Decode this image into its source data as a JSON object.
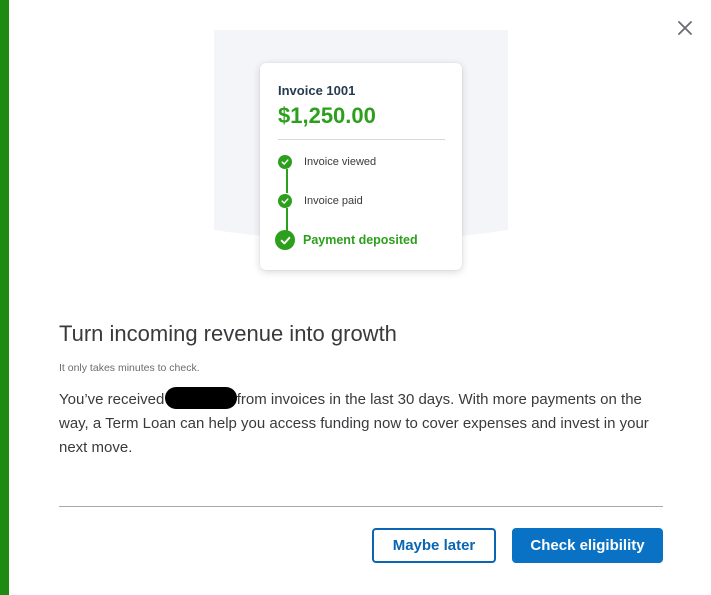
{
  "modal": {
    "accent_color": "#1e8a12",
    "close_icon": "close-icon"
  },
  "invoice_card": {
    "title": "Invoice 1001",
    "amount": "$1,250.00",
    "steps": [
      {
        "label": "Invoice viewed",
        "icon": "check-icon"
      },
      {
        "label": "Invoice paid",
        "icon": "check-icon"
      },
      {
        "label": "Payment deposited",
        "icon": "check-icon"
      }
    ],
    "amount_color": "#2ca01c"
  },
  "content": {
    "heading": "Turn incoming revenue into growth",
    "subtext": "It only takes minutes to check.",
    "body_before_redaction": "You’ve received",
    "body_after_redaction": "from invoices in the last 30 days. With more payments on the way, a Term Loan can help you access funding now to cover expenses and invest in your next move."
  },
  "footer": {
    "secondary_label": "Maybe later",
    "primary_label": "Check eligibility",
    "primary_color": "#0a72c4"
  }
}
